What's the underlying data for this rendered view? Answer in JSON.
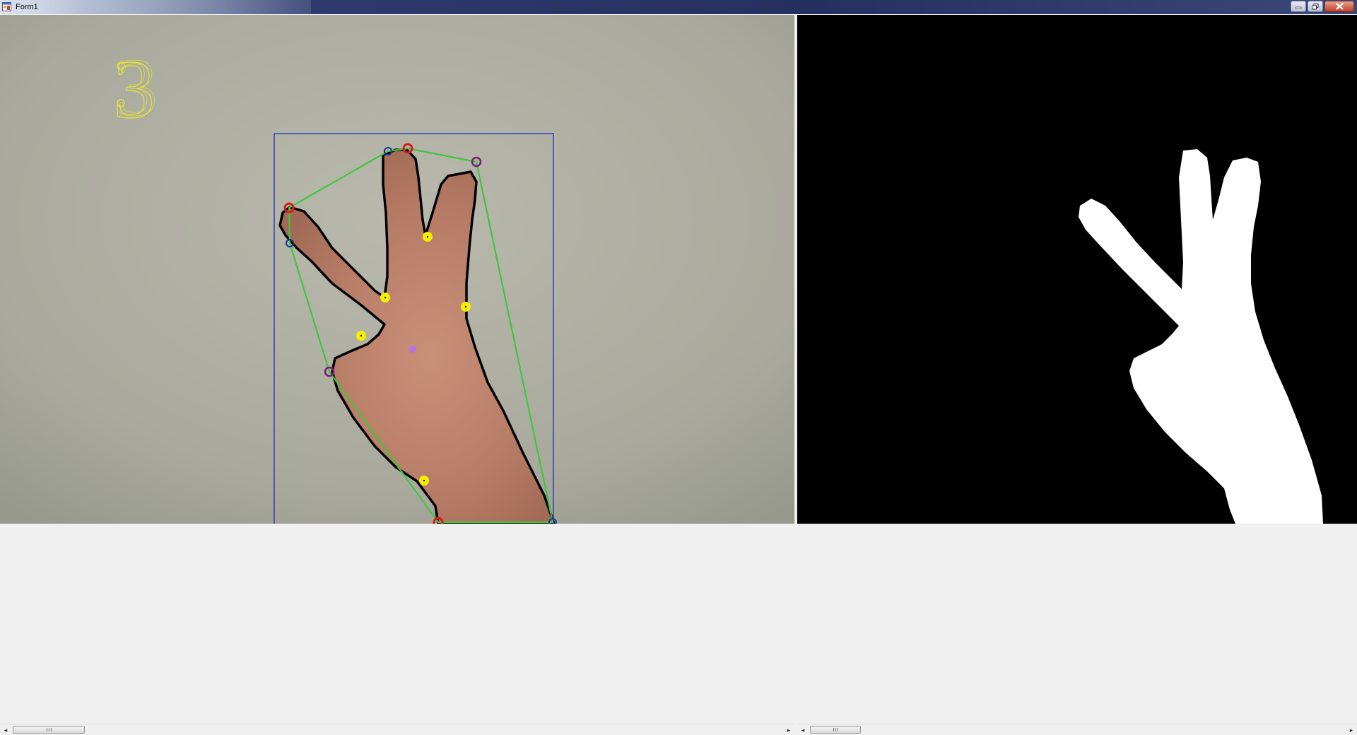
{
  "window": {
    "title": "Form1",
    "buttons": {
      "minimize": "minimize",
      "maximize": "maximize",
      "close": "close"
    }
  },
  "camera_view": {
    "gesture_count": "3",
    "colors": {
      "count_text": "#e6e633",
      "bounding_box": "#1a2bbf",
      "convex_hull": "#3fc63f",
      "contour": "#000000",
      "hull_points": "#e01818",
      "start_points": "#1d2f9c",
      "end_points": "#7a1a7a",
      "defect_points": "#f5f000",
      "center_point": "#b86fe0"
    }
  },
  "mask_view": {
    "background": "#000000",
    "foreground": "#ffffff"
  },
  "scrollbars": {
    "left": {
      "thumb_position": 0.01
    },
    "right": {
      "thumb_position": 0.02
    }
  }
}
